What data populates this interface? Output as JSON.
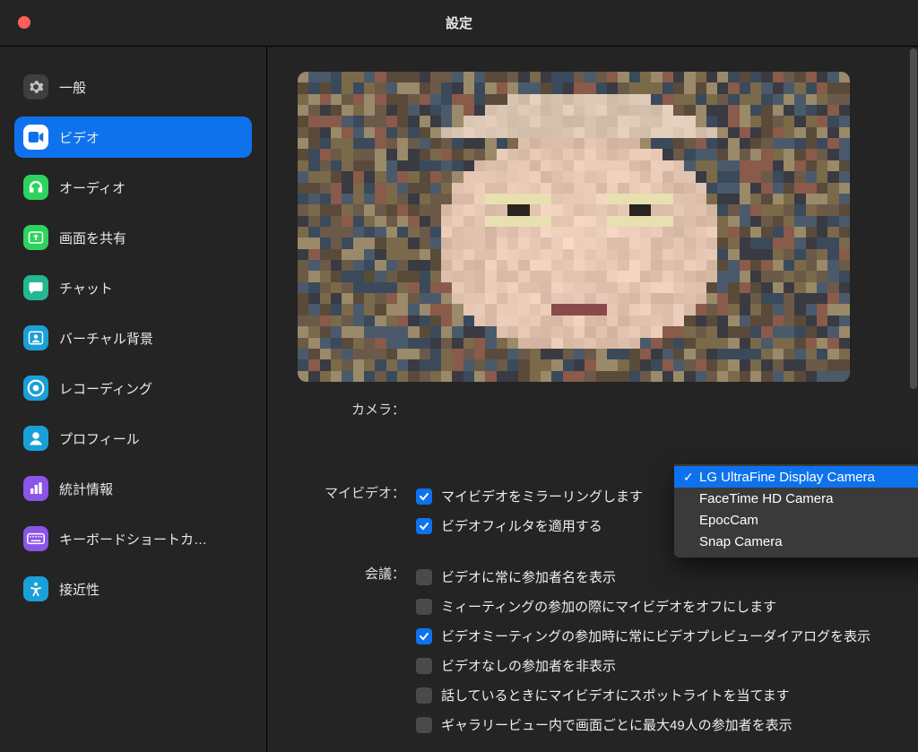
{
  "window": {
    "title": "設定"
  },
  "sidebar": {
    "items": [
      {
        "label": "一般",
        "icon": "gear",
        "bg": "#3f3f3f",
        "fg": "#d0d0d0"
      },
      {
        "label": "ビデオ",
        "icon": "video",
        "bg": "#ffffff",
        "fg": "#0e72ed",
        "active": true
      },
      {
        "label": "オーディオ",
        "icon": "headset",
        "bg": "#2dd35d",
        "fg": "#ffffff"
      },
      {
        "label": "画面を共有",
        "icon": "share",
        "bg": "#2dd35d",
        "fg": "#ffffff"
      },
      {
        "label": "チャット",
        "icon": "chat",
        "bg": "#23b890",
        "fg": "#ffffff"
      },
      {
        "label": "バーチャル背景",
        "icon": "user-bg",
        "bg": "#1aa0d8",
        "fg": "#ffffff"
      },
      {
        "label": "レコーディング",
        "icon": "record",
        "bg": "#1aa0d8",
        "fg": "#ffffff"
      },
      {
        "label": "プロフィール",
        "icon": "profile",
        "bg": "#1aa0d8",
        "fg": "#ffffff"
      },
      {
        "label": "統計情報",
        "icon": "stats",
        "bg": "#8b55e9",
        "fg": "#ffffff"
      },
      {
        "label": "キーボードショートカ…",
        "icon": "keyboard",
        "bg": "#8b55e9",
        "fg": "#ffffff"
      },
      {
        "label": "接近性",
        "icon": "accessibility",
        "bg": "#1aa0d8",
        "fg": "#ffffff"
      }
    ]
  },
  "video": {
    "camera_label": "カメラ：",
    "camera_dropdown": {
      "selected_index": 0,
      "options": [
        "LG UltraFine Display Camera",
        "FaceTime HD Camera",
        "EpocCam",
        "Snap Camera"
      ]
    },
    "myvideo_label": "マイビデオ：",
    "myvideo_options": [
      {
        "label": "マイビデオをミラーリングします",
        "checked": true
      },
      {
        "label": "ビデオフィルタを適用する",
        "checked": true
      }
    ],
    "meeting_label": "会議：",
    "meeting_options": [
      {
        "label": "ビデオに常に参加者名を表示",
        "checked": false
      },
      {
        "label": "ミィーティングの参加の際にマイビデオをオフにします",
        "checked": false
      },
      {
        "label": "ビデオミーティングの参加時に常にビデオプレビューダイアログを表示",
        "checked": true
      },
      {
        "label": "ビデオなしの参加者を非表示",
        "checked": false
      },
      {
        "label": "話しているときにマイビデオにスポットライトを当てます",
        "checked": false
      },
      {
        "label": "ギャラリービュー内で画面ごとに最大49人の参加者を表示",
        "checked": false
      }
    ]
  }
}
